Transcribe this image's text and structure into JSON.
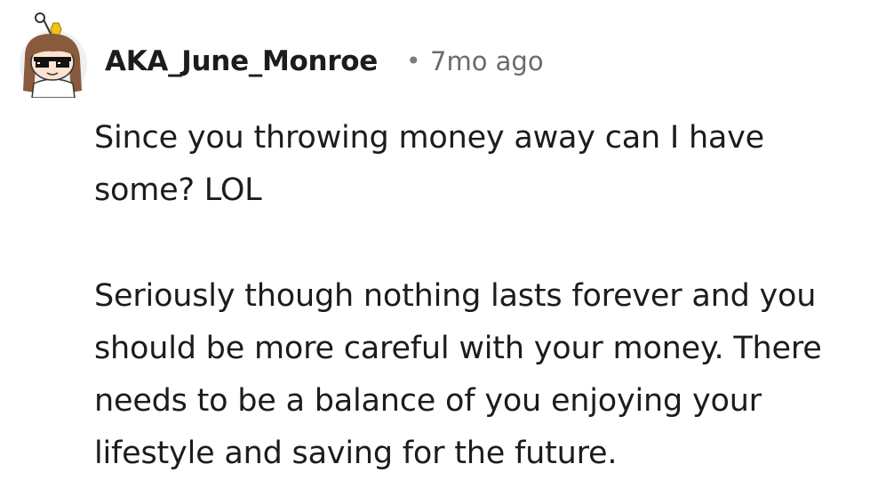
{
  "comment": {
    "author": "AKA_June_Monroe",
    "separator": "•",
    "timestamp": "7mo ago",
    "paragraphs": [
      "Since you throwing money away can I have\nsome? LOL",
      "Seriously though nothing lasts forever and you\nshould be more careful with your money. There\nneeds to be a balance of you enjoying your\nlifestyle and saving for the future."
    ],
    "avatar_icon": "user-avatar-snoo-with-sunglasses-icon",
    "colors": {
      "text": "#1c1c1c",
      "meta": "#6b6b6b",
      "avatar_bg": "#eef0f2",
      "crown": "#f2c218"
    }
  }
}
